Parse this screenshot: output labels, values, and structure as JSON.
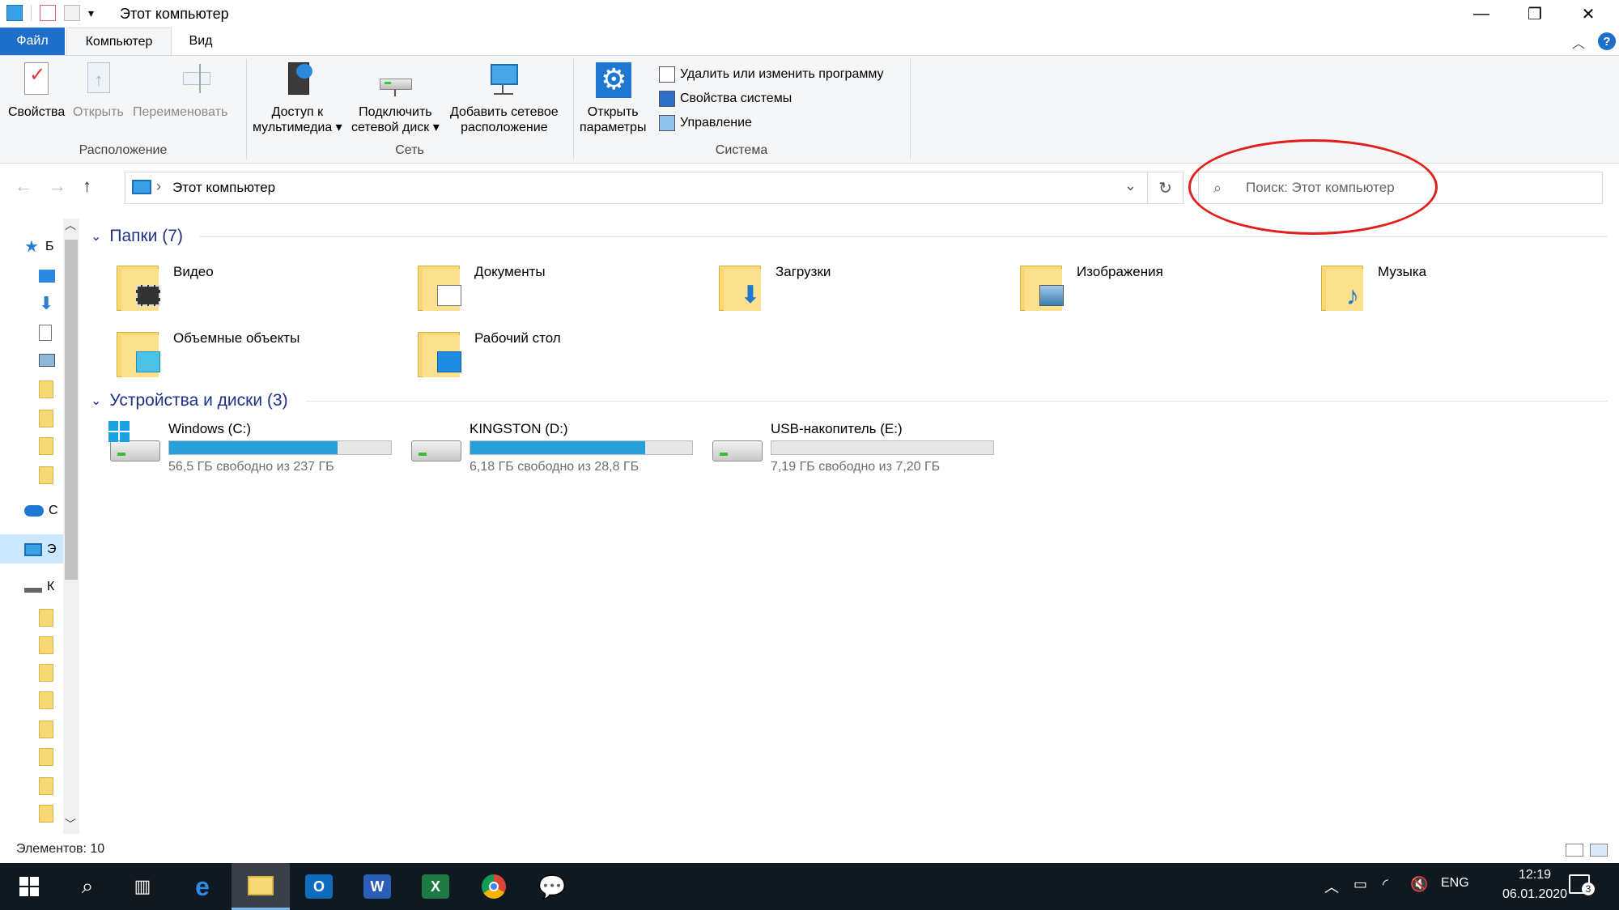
{
  "window": {
    "title": "Этот компьютер",
    "minimize_glyph": "—",
    "restore_glyph": "❐",
    "close_glyph": "✕"
  },
  "tabs": {
    "file": "Файл",
    "computer": "Компьютер",
    "view": "Вид",
    "help_glyph": "?"
  },
  "ribbon": {
    "properties": "Свойства",
    "open": "Открыть",
    "rename": "Переименовать",
    "group_location": "Расположение",
    "media_access_line1": "Доступ к",
    "media_access_line2": "мультимедиа ▾",
    "map_drive_line1": "Подключить",
    "map_drive_line2": "сетевой диск ▾",
    "add_network_line1": "Добавить сетевое",
    "add_network_line2": "расположение",
    "group_network": "Сеть",
    "open_settings_line1": "Открыть",
    "open_settings_line2": "параметры",
    "uninstall": "Удалить или изменить программу",
    "system_props": "Свойства системы",
    "manage": "Управление",
    "group_system": "Система"
  },
  "address": {
    "path": "Этот компьютер",
    "search_placeholder": "Поиск: Этот компьютер"
  },
  "nav": {
    "quick_access": "Б",
    "onedrive": "С",
    "this_pc": "Э",
    "kingston": "К"
  },
  "sections": {
    "folders_header": "Папки (7)",
    "devices_header": "Устройства и диски (3)"
  },
  "folders": [
    {
      "name": "Видео",
      "badge": "film-strip-icon"
    },
    {
      "name": "Документы",
      "badge": "document-icon"
    },
    {
      "name": "Загрузки",
      "badge": "download-arrow-icon"
    },
    {
      "name": "Изображения",
      "badge": "picture-icon"
    },
    {
      "name": "Музыка",
      "badge": "music-note-icon"
    },
    {
      "name": "Объемные объекты",
      "badge": "cube-icon"
    },
    {
      "name": "Рабочий стол",
      "badge": "desktop-icon"
    }
  ],
  "drives": [
    {
      "name": "Windows (C:)",
      "free_text": "56,5 ГБ свободно из 237 ГБ",
      "used_fraction": 0.76
    },
    {
      "name": "KINGSTON (D:)",
      "free_text": "6,18 ГБ свободно из 28,8 ГБ",
      "used_fraction": 0.79
    },
    {
      "name": "USB-накопитель (E:)",
      "free_text": "7,19 ГБ свободно из 7,20 ГБ",
      "used_fraction": 0.0
    }
  ],
  "status": {
    "items_count": "Элементов: 10"
  },
  "taskbar": {
    "outlook_letter": "O",
    "word_letter": "W",
    "excel_letter": "X",
    "lang": "ENG",
    "time": "12:19",
    "date": "06.01.2020",
    "notification_count": "3"
  },
  "colors": {
    "accent": "#1e6fc9",
    "drive_fill": "#26a0da",
    "search_highlight": "#e0201c",
    "folder_yellow": "#f8d775"
  }
}
